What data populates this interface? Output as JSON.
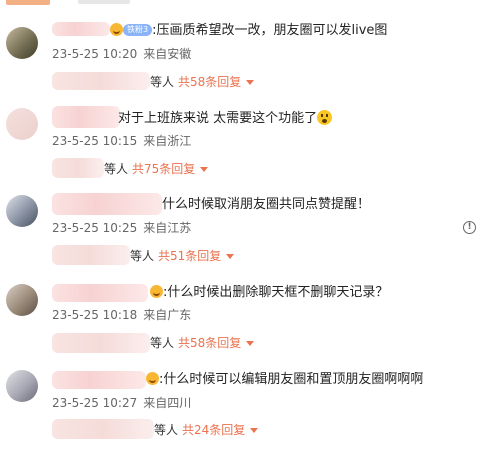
{
  "comments": [
    {
      "text": ":压画质希望改一改，朋友圈可以发live图",
      "badge": "铁粉3",
      "time": "23-5-25 10:20",
      "location": "来自安徽",
      "reply_etc": "等人",
      "reply_count": "共58条回复"
    },
    {
      "text": "对于上班族来说 太需要这个功能了",
      "time": "23-5-25 10:15",
      "location": "来自浙江",
      "reply_etc": "等人",
      "reply_count": "共75条回复"
    },
    {
      "text": "什么时候取消朋友圈共同点赞提醒！",
      "time": "23-5-25 10:25",
      "location": "来自江苏",
      "reply_etc": "等人",
      "reply_count": "共51条回复"
    },
    {
      "text": ":什么时候出删除聊天框不删聊天记录？",
      "time": "23-5-25 10:18",
      "location": "来自广东",
      "reply_etc": "等人",
      "reply_count": "共58条回复"
    },
    {
      "text": ":什么时候可以编辑朋友圈和置顶朋友圈啊啊啊",
      "time": "23-5-25 10:27",
      "location": "来自四川",
      "reply_etc": "等人",
      "reply_count": "共24条回复"
    }
  ],
  "icons": {
    "info": "info-circle-icon",
    "caret": "caret-down-icon"
  },
  "colors": {
    "reply_link": "#eb7350",
    "meta_text": "#666666"
  }
}
